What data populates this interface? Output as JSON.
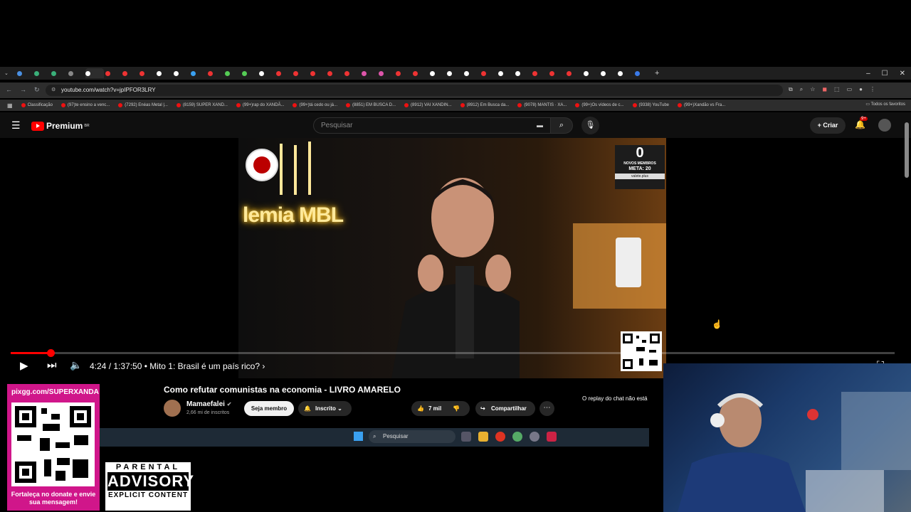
{
  "browser": {
    "url": "youtube.com/watch?v=jpIPFOR3LRY",
    "window_controls": {
      "minimize": "–",
      "maximize": "☐",
      "close": "✕"
    },
    "bookmarks": [
      {
        "label": "Classificação"
      },
      {
        "label": "(97)te ensino a venc..."
      },
      {
        "label": "(7292) Enéas Metal |..."
      },
      {
        "label": "(8159) SUPER XAND..."
      },
      {
        "label": "(99+)rap do XANDÃ..."
      },
      {
        "label": "(99+)tá cedo ou já..."
      },
      {
        "label": "(8851) EM BUSCA D..."
      },
      {
        "label": "(8912) VAI XANDIN..."
      },
      {
        "label": "(8912) Em Busca da..."
      },
      {
        "label": "(9078) MANTIS · XA..."
      },
      {
        "label": "(99+)Os vídeos de c..."
      },
      {
        "label": "(9338) YouTube"
      },
      {
        "label": "(99+)Xandão vs Fra..."
      }
    ],
    "all_bookmarks": "Todos os favoritos"
  },
  "youtube": {
    "logo_text": "Premium",
    "logo_region": "BR",
    "search_placeholder": "Pesquisar",
    "create_label": "Criar",
    "notifications_badge": "9+"
  },
  "video": {
    "neon_text": "lemia MBL",
    "counter": {
      "number": "0",
      "label": "NOVOS MEMBROS",
      "meta": "META: 20",
      "site": "valete.plus"
    },
    "progress_fraction": 0.045,
    "time_display": "4:24 / 1:37:50",
    "chapter": "• Mito 1: Brasil é um país rico? ›",
    "title": "Como refutar comunistas na economia - LIVRO AMARELO",
    "channel": "Mamaefalei",
    "subscribers": "2,66 mi de inscritos",
    "member_label": "Seja membro",
    "subscribed_label": "Inscrito",
    "likes": "7 mil",
    "share_label": "Compartilhar",
    "chat_note": "O replay do chat não está"
  },
  "taskbar": {
    "search_placeholder": "Pesquisar"
  },
  "overlay": {
    "donate_url": "pixgg.com/SUPERXANDA",
    "donate_msg": "Fortaleça no donate e envie sua mensagem!",
    "advisory_top": "PARENTAL",
    "advisory_mid": "ADVISORY",
    "advisory_bot": "EXPLICIT CONTENT"
  },
  "colors": {
    "youtube_red": "#ff0000",
    "donate_pink": "#d0168a",
    "background": "#0f0f0f"
  }
}
